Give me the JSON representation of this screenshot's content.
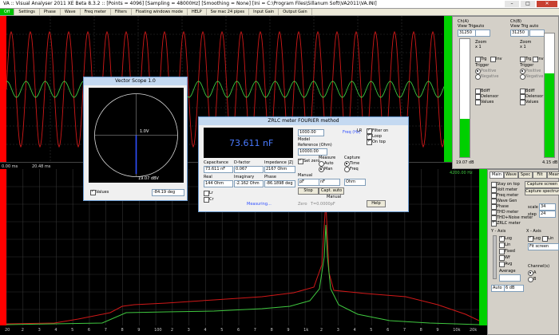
{
  "window": {
    "title": "VA :: Visual Analyser 2011 XE Beta 8.3.2 :: [Points = 4096] [Sampling = 48000Hz] [Smoothing = None] [Ini = C:\\Program Files\\Sillanum Soft\\VA2011\\VA.INI]"
  },
  "menu": [
    "Off",
    "Settings",
    "Phase",
    "Wave",
    "Freq meter",
    "Filters",
    "Floating windows mode",
    "HELP",
    "Sw mac 24 pipes",
    "Input Gain",
    "Output Gain"
  ],
  "scope": {
    "left_status": "0.00 ms",
    "left_status2": "20.48 ms"
  },
  "right_scope_panel": {
    "ch_a": {
      "label": "Ch(A)",
      "view_trig": "View Trig",
      "value": "31250",
      "auto": "auto",
      "zoom": "Zoom",
      "zoom_val": "x 1",
      "trigger": "Trigger",
      "trigger_opts": [
        "Positive",
        "Negative"
      ],
      "trg": "Trg",
      "inv": "Inv",
      "checks": [
        "Bdiff",
        "Delensor",
        "Values"
      ],
      "bottom_val": "19.07 dB"
    },
    "ch_b": {
      "label": "Ch(B)",
      "view_trig": "View Trig",
      "value": "31250",
      "auto": "auto",
      "zoom": "Zoom",
      "zoom_val": "x 1",
      "trigger": "Trigger",
      "trigger_opts": [
        "Positive",
        "Negative"
      ],
      "trg": "Trg",
      "inv": "Inv",
      "checks": [
        "Bdiff",
        "Delensor",
        "Values"
      ],
      "bottom_val": "4.15 dB"
    }
  },
  "spectrum_panel": {
    "tabs": [
      "Main",
      "Wave",
      "Spec",
      "Filt",
      "Mean"
    ],
    "checks": [
      "Stay on top",
      "Volt meter",
      "Freq meter",
      "Wave Gen",
      "Phase",
      "THD meter",
      "THD+Noise meter",
      "ZRLC meter"
    ],
    "capture": [
      "Capture screen",
      "Capture spectrum"
    ],
    "scale_label": "scale",
    "scale_val": "34",
    "step_label": "step",
    "step_val": "24",
    "sub_labels": [
      "Y - Axis",
      "X - Axis"
    ],
    "axis_checks": [
      "Log",
      "Lin",
      "Fixed",
      "Wf",
      "Avg"
    ],
    "fit_screen": "Fit screen",
    "average": "Average",
    "db_val": "6 dB",
    "channels": "Channel(s)",
    "ch_opts": [
      "A",
      "B"
    ],
    "auto": "Auto",
    "top_freq": "4200.00 Hz"
  },
  "vector_scope": {
    "title": "Vector Scope 1.0",
    "label_x": "1.0V",
    "values_label": "Values",
    "value": "-84.19 deg",
    "readout": "19.07 dBV"
  },
  "zrlc": {
    "title": "ZRLC meter FOURIER method",
    "reading": "73.611 nF",
    "fields_top": [
      {
        "label": "Capacitance",
        "value": "73.611 nF"
      },
      {
        "label": "D-factor",
        "value": "0.067"
      },
      {
        "label": "Impedance |Z|",
        "value": "2167 Ohm"
      }
    ],
    "fields_bot": [
      {
        "label": "Real",
        "value": "144 Ohm"
      },
      {
        "label": "Imaginary",
        "value": "-2.162 Ohm"
      },
      {
        "label": "Phase",
        "value": "-86.1898 deg"
      }
    ],
    "freq_label": "Freq (Hz)",
    "freq_val": "1000.00",
    "reference_label": "Reference (Ohm)",
    "reference_val": "10000.00",
    "model_label": "Model",
    "checks_right": [
      "Filter on",
      "Loop",
      "On top"
    ],
    "measure_label": "Measure",
    "measure_opts": [
      "Auto",
      "Man"
    ],
    "capture_label": "Capture",
    "capture_opts": [
      "Time",
      "Freq"
    ],
    "set_zero": "Set zero",
    "manual": "Manual",
    "lr_label": "LR",
    "units": [
      "pF",
      "nF",
      "Ohm"
    ],
    "stop": "Stop",
    "capt_auto": "Capt. auto",
    "capt_manual": "Manual",
    "zero": "Zero",
    "zero_val": "T=0.0000pF",
    "help": "Help",
    "measuring": "Measuring...",
    "side_checks": [
      "Lr",
      "Cr"
    ]
  },
  "spectrum": {
    "xticks": [
      "20",
      "2",
      "3",
      "4",
      "5",
      "6",
      "7",
      "8",
      "9",
      "100",
      "2",
      "3",
      "4",
      "5",
      "6",
      "7",
      "8",
      "9",
      "1k",
      "2",
      "3",
      "4",
      "5",
      "6",
      "7",
      "8",
      "9",
      "10k",
      "20k"
    ]
  },
  "colors": {
    "plot_bg": "#000000",
    "red": "#ff0000",
    "green": "#00d000",
    "trace_red": "#d01818",
    "trace_green": "#3fc83f",
    "grid": "#3a3a3a"
  }
}
